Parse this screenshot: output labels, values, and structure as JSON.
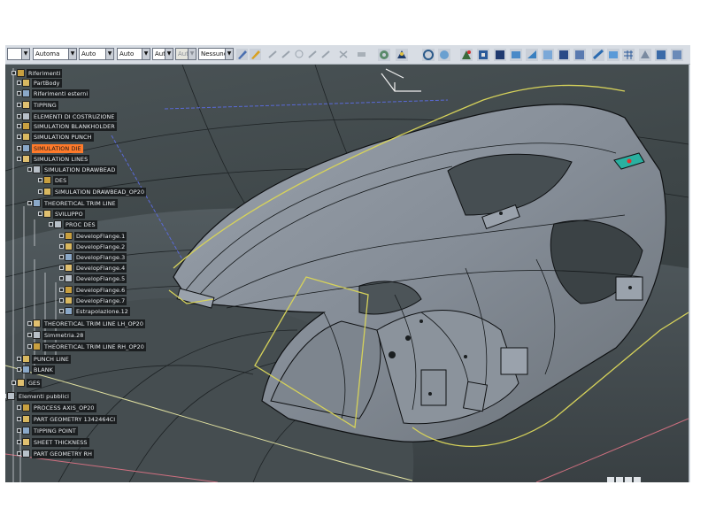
{
  "toolbar": {
    "selects": [
      {
        "value": "",
        "disabled": false
      },
      {
        "value": "Automa",
        "disabled": false
      },
      {
        "value": "Auto",
        "disabled": false
      },
      {
        "value": "Auto",
        "disabled": false
      },
      {
        "value": "Aut",
        "disabled": false
      },
      {
        "value": "Aut",
        "disabled": true
      },
      {
        "value": "Nessunc",
        "disabled": false
      }
    ]
  },
  "tree": {
    "nodes": [
      {
        "label": "Riferimenti"
      },
      {
        "label": "PartBody"
      },
      {
        "label": "Riferimenti esterni"
      },
      {
        "label": "TIPPING"
      },
      {
        "label": "ELEMENTI DI COSTRUZIONE"
      },
      {
        "label": "SIMULATION BLANKHOLDER"
      },
      {
        "label": "SIMULATION PUNCH"
      },
      {
        "label": "SIMULATION DIE",
        "selected": true
      },
      {
        "label": "SIMULATION LINES"
      },
      {
        "label": "SIMULATION DRAWBEAD"
      },
      {
        "label": "DES"
      },
      {
        "label": "SIMULATION DRAWBEAD_OP20"
      },
      {
        "label": "THEORETICAL TRIM LINE"
      },
      {
        "label": "SVILUPPO"
      },
      {
        "label": "PROC DES"
      },
      {
        "label": "DevelopFlange.1"
      },
      {
        "label": "DevelopFlange.2"
      },
      {
        "label": "DevelopFlange.3"
      },
      {
        "label": "DevelopFlange.4"
      },
      {
        "label": "DevelopFlange.5"
      },
      {
        "label": "DevelopFlange.6"
      },
      {
        "label": "DevelopFlange.7"
      },
      {
        "label": "Estrapolazione.12"
      },
      {
        "label": "THEORETICAL TRIM LINE LH_OP20"
      },
      {
        "label": "Simmetria.28"
      },
      {
        "label": "THEORETICAL TRIM LINE RH_OP20"
      },
      {
        "label": "PUNCH LINE"
      },
      {
        "label": "BLANK"
      },
      {
        "label": "GES"
      },
      {
        "label": "Elementi pubblici"
      },
      {
        "label": "PROCESS AXIS_OP20"
      },
      {
        "label": "PART GEOMETRY 1342464CI"
      },
      {
        "label": "TIPPING POINT"
      },
      {
        "label": "SHEET THICKNESS"
      },
      {
        "label": "PART GEOMETRY RH"
      }
    ]
  },
  "colors": {
    "background": "#3e4648",
    "surface": "#8c949e",
    "edge": "#0e1012",
    "trim_line": "#d6d25a",
    "selection": "#ff7a2a"
  },
  "icons": {
    "toolbar": [
      "brush-icon",
      "pencil-icon",
      "snap-icon",
      "wand-icon",
      "cursor-icon",
      "grid-icon",
      "sketch-icon",
      "axis-icon",
      "measure-icon",
      "rotate-icon",
      "zoom-icon",
      "fit-icon",
      "view-icon",
      "render-icon",
      "hide-icon",
      "swap-icon",
      "layer-icon",
      "plane-icon",
      "point-icon",
      "line-icon",
      "curve-icon"
    ],
    "right": [
      "select-icon",
      "pan-icon",
      "surface-icon",
      "extrude-icon",
      "revolve-icon",
      "sweep-icon",
      "fill-icon",
      "blend-icon",
      "trim-icon",
      "split-icon",
      "join-icon",
      "heal-icon",
      "offset-icon",
      "flange-icon",
      "develop-icon",
      "translate-icon",
      "rotate-tool-icon",
      "mirror-icon",
      "scale-icon",
      "pattern-icon",
      "extract-icon",
      "analysis-icon",
      "curvature-icon"
    ]
  }
}
